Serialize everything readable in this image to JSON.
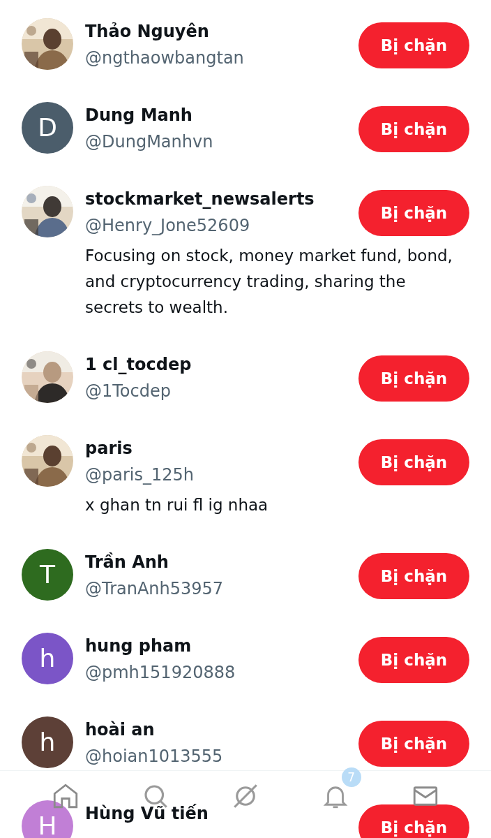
{
  "accounts": [
    {
      "name": "Thảo Nguyên",
      "handle": "@ngthaowbangtan",
      "button": "Bị chặn"
    },
    {
      "name": "Dung Manh",
      "handle": "@DungManhvn",
      "avatar": {
        "kind": "letter",
        "letter": "D",
        "color": "#4b5d6b"
      },
      "button": "Bị chặn"
    },
    {
      "name": "stockmarket_newsalerts",
      "handle": "@Henry_Jone52609",
      "bio": "Focusing on stock, money market fund, bond, and cryptocurrency trading, sharing the secrets to wealth.",
      "button": "Bị chặn"
    },
    {
      "name": "1 cl_tocdep",
      "handle": "@1Tocdep",
      "button": "Bị chặn"
    },
    {
      "name": "paris",
      "handle": "@paris_125h",
      "bio": "x ghan tn rui fl ig nhaa",
      "button": "Bị chặn"
    },
    {
      "name": "Trần Anh",
      "handle": "@TranAnh53957",
      "avatar": {
        "kind": "letter",
        "letter": "T",
        "color": "#2e6b1f"
      },
      "button": "Bị chặn"
    },
    {
      "name": "hung pham",
      "handle": "@pmh151920888",
      "avatar": {
        "kind": "letter",
        "letter": "h",
        "color": "#7b55c7"
      },
      "button": "Bị chặn"
    },
    {
      "name": "hoài an",
      "handle": "@hoian1013555",
      "avatar": {
        "kind": "letter",
        "letter": "h",
        "color": "#5d4037"
      },
      "button": "Bị chặn"
    },
    {
      "name": "Hùng Vũ tiến",
      "avatar": {
        "kind": "letter",
        "letter": "H",
        "color": "#c17fd6"
      },
      "button": "Bị chặn"
    }
  ],
  "bottom_nav": {
    "notification_badge": "7"
  }
}
